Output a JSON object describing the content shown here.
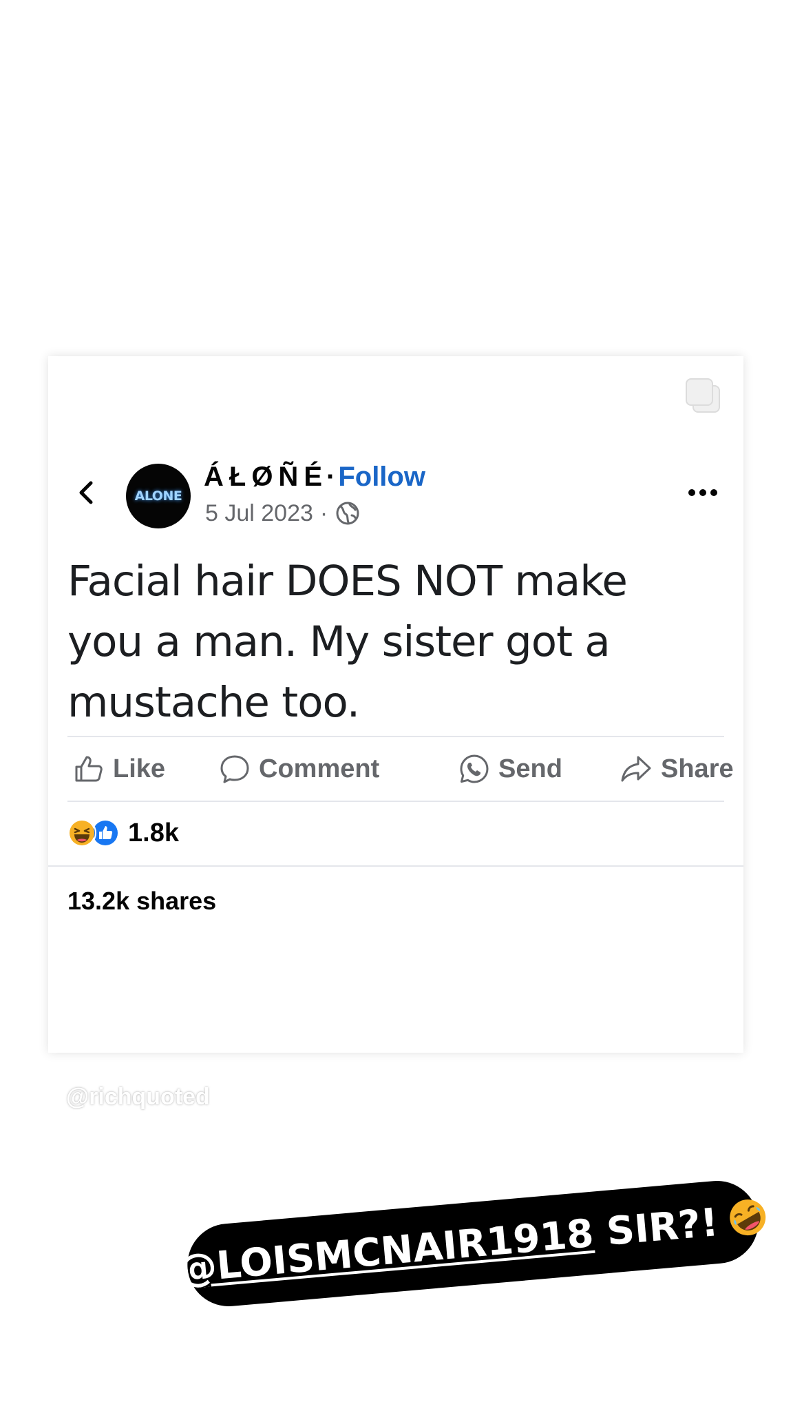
{
  "post": {
    "author": "ÁŁØÑÉ",
    "separator": "·",
    "follow_label": "Follow",
    "date": "5 Jul 2023",
    "meta_separator": "·",
    "avatar_text": "ALONE",
    "text": "Facial hair DOES NOT make you a man. My sister got a mustache too.",
    "visibility_icon": "globe-icon"
  },
  "actions": [
    {
      "label": "Like",
      "icon": "thumbs-up-icon"
    },
    {
      "label": "Comment",
      "icon": "comment-bubble-icon"
    },
    {
      "label": "Send",
      "icon": "whatsapp-icon"
    },
    {
      "label": "Share",
      "icon": "share-arrow-icon"
    }
  ],
  "reactions": {
    "count": "1.8k",
    "types": [
      "haha",
      "like"
    ]
  },
  "shares": "13.2k shares",
  "watermark": "@richquoted",
  "sticker": {
    "mention": "@LOISMCNAIR1918",
    "text": " SIR?!",
    "emoji": "rolling-on-floor-laughing-emoji"
  },
  "colors": {
    "follow": "#1a66c7",
    "secondary_text": "#65676b",
    "sticker_bg": "#000000",
    "like_blue": "#1877f2",
    "haha_yellow": "#f7b125"
  }
}
